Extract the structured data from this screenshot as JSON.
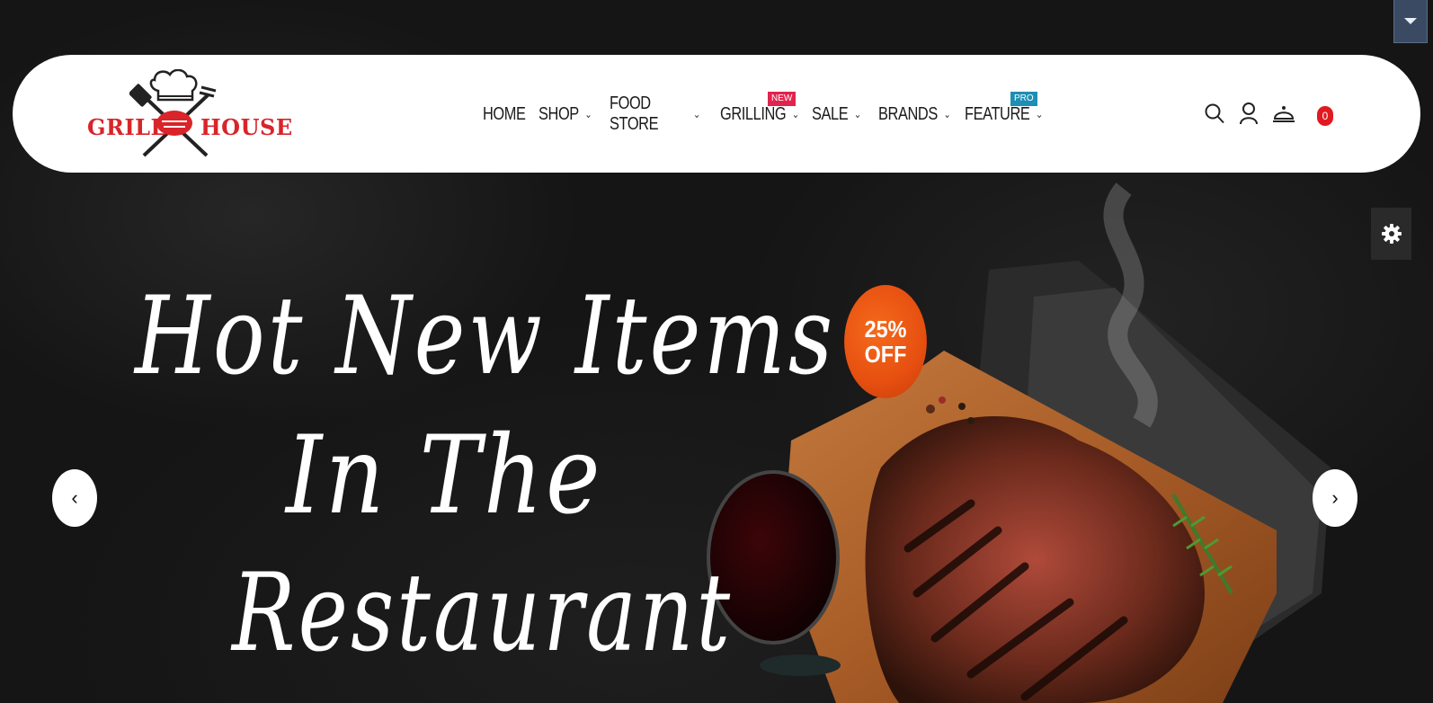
{
  "brand": {
    "word_left": "GRILL",
    "word_right": "HOUSE",
    "color": "#d9242a"
  },
  "nav": {
    "items": [
      {
        "label": "HOME",
        "has_dropdown": false,
        "badge": ""
      },
      {
        "label": "SHOP",
        "has_dropdown": true,
        "badge": ""
      },
      {
        "label": "FOOD STORE",
        "has_dropdown": true,
        "badge": ""
      },
      {
        "label": "GRILLING",
        "has_dropdown": true,
        "badge": "NEW"
      },
      {
        "label": "SALE",
        "has_dropdown": true,
        "badge": ""
      },
      {
        "label": "BRANDS",
        "has_dropdown": true,
        "badge": ""
      },
      {
        "label": "FEATURE",
        "has_dropdown": true,
        "badge": "PRO"
      }
    ]
  },
  "header_icons": {
    "search": "search-icon",
    "account": "user-icon",
    "cart": "cloche-icon",
    "cart_count": "0"
  },
  "hero": {
    "line1": "Hot New Items",
    "line2": "In The",
    "line3": "Restaurant",
    "discount_value": "25%",
    "discount_word": "OFF",
    "prev_label": "‹",
    "next_label": "›"
  },
  "colors": {
    "accent": "#e01a1f",
    "badge_new": "#e1244d",
    "badge_pro": "#1d8eb4",
    "discount": "#e64f10"
  }
}
